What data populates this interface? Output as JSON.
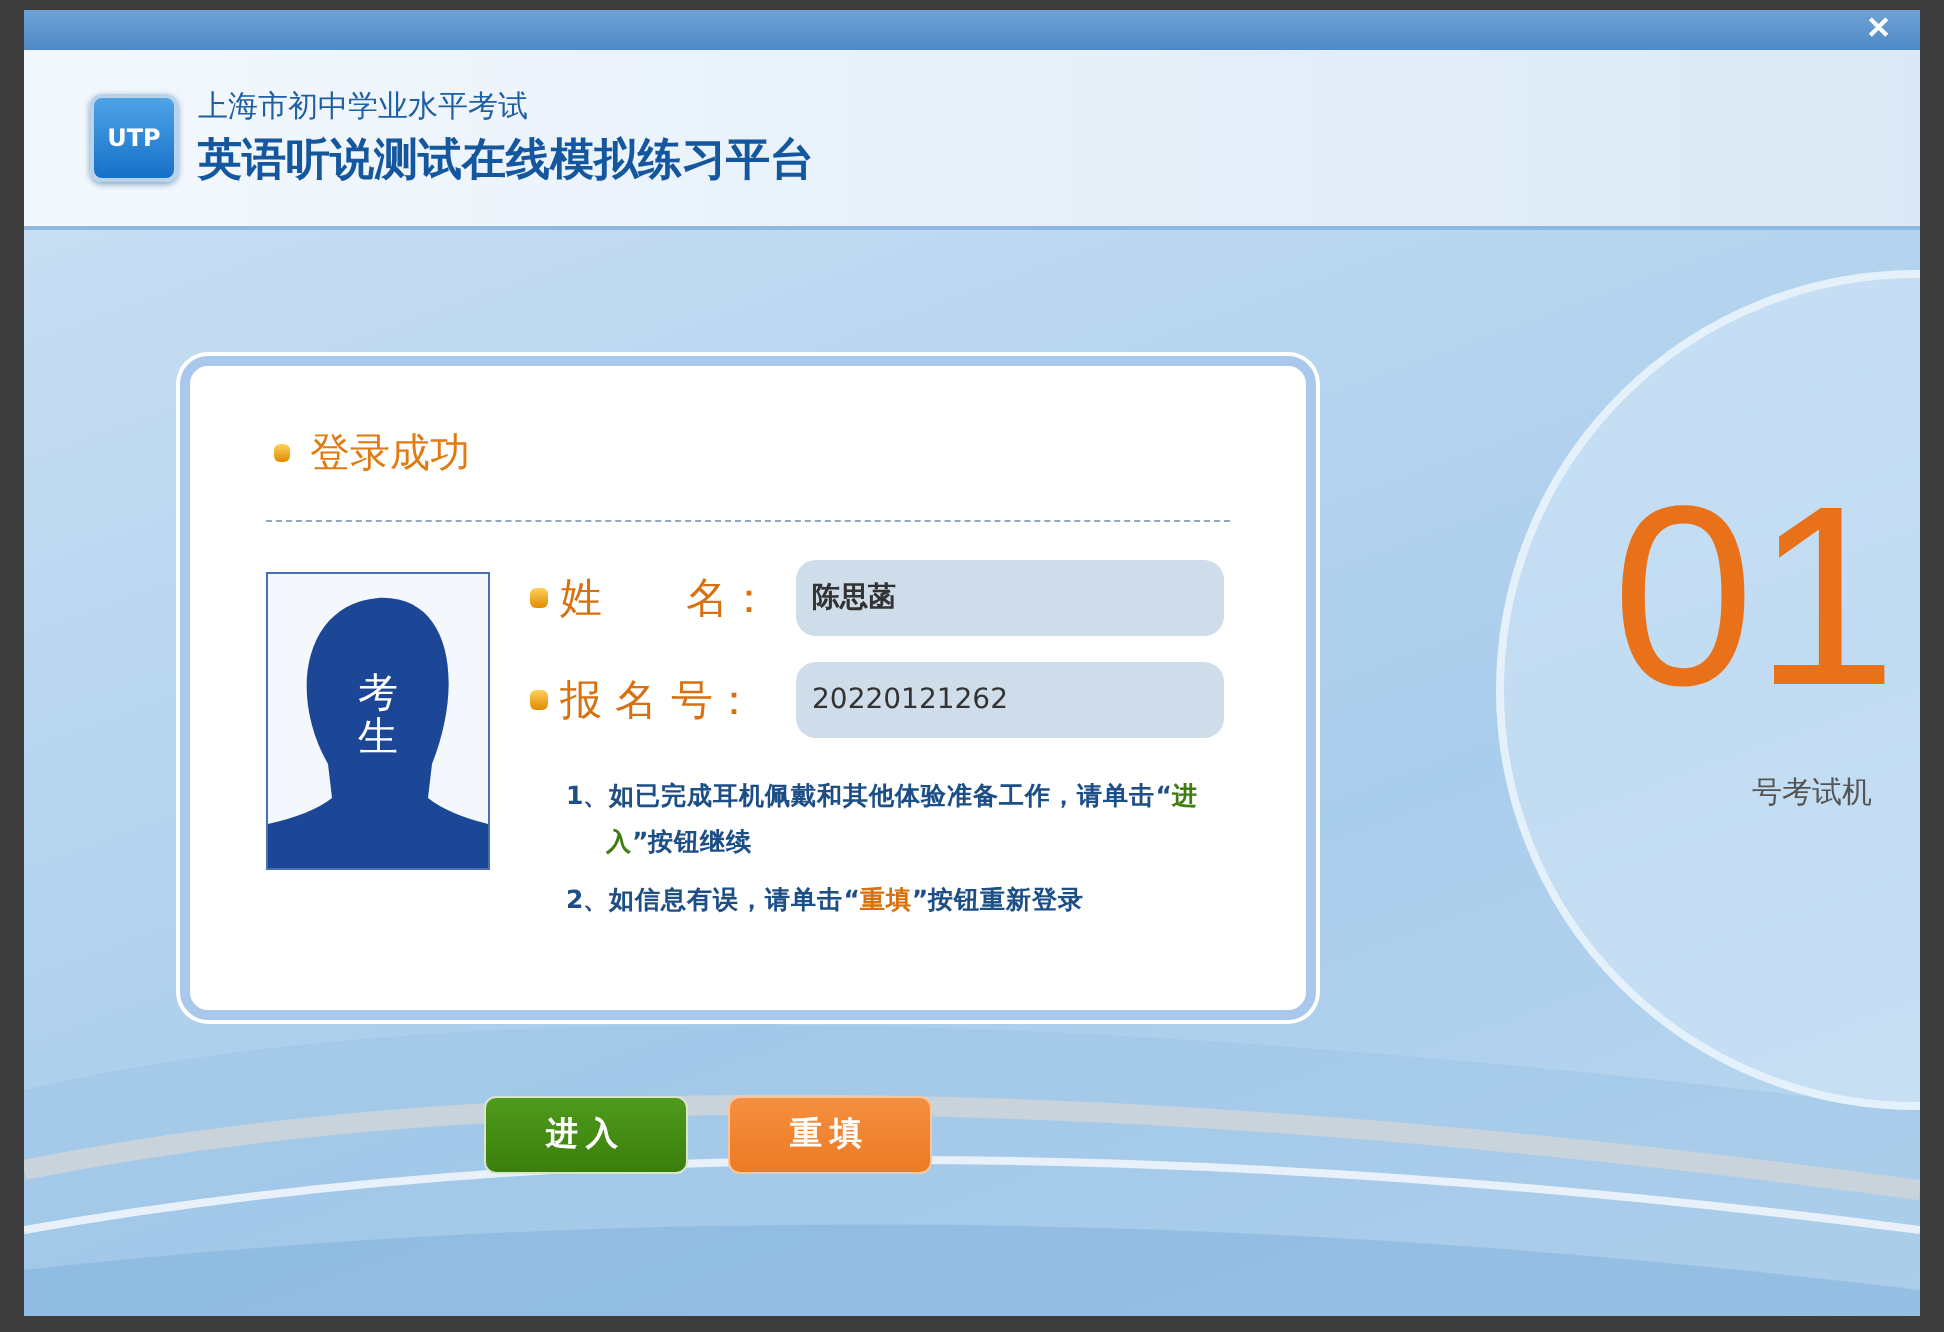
{
  "window": {
    "close_label": "✕"
  },
  "header": {
    "logo_text": "UTP",
    "subtitle": "上海市初中学业水平考试",
    "title": "英语听说测试在线模拟练习平台"
  },
  "login_card": {
    "heading": "登录成功",
    "photo_caption": "考生",
    "fields": [
      {
        "label": "姓　　名：",
        "value": "陈思菡",
        "bold": true
      },
      {
        "label": "报 名 号：",
        "value": "20220121262",
        "bold": false
      }
    ],
    "instructions": [
      {
        "text": "1、如已完成耳机佩戴和其他体验准备工作，请单击“**进入**”按钮继续",
        "color": "#3f7d12"
      },
      {
        "text": "2、如信息有误，请单击“**重填**”按钮重新登录",
        "color": "#d9700e"
      }
    ]
  },
  "buttons": [
    {
      "label": "进入",
      "kind": "primary"
    },
    {
      "label": "重填",
      "kind": "reset"
    }
  ],
  "machine": {
    "number": "01",
    "caption": "号考试机"
  }
}
